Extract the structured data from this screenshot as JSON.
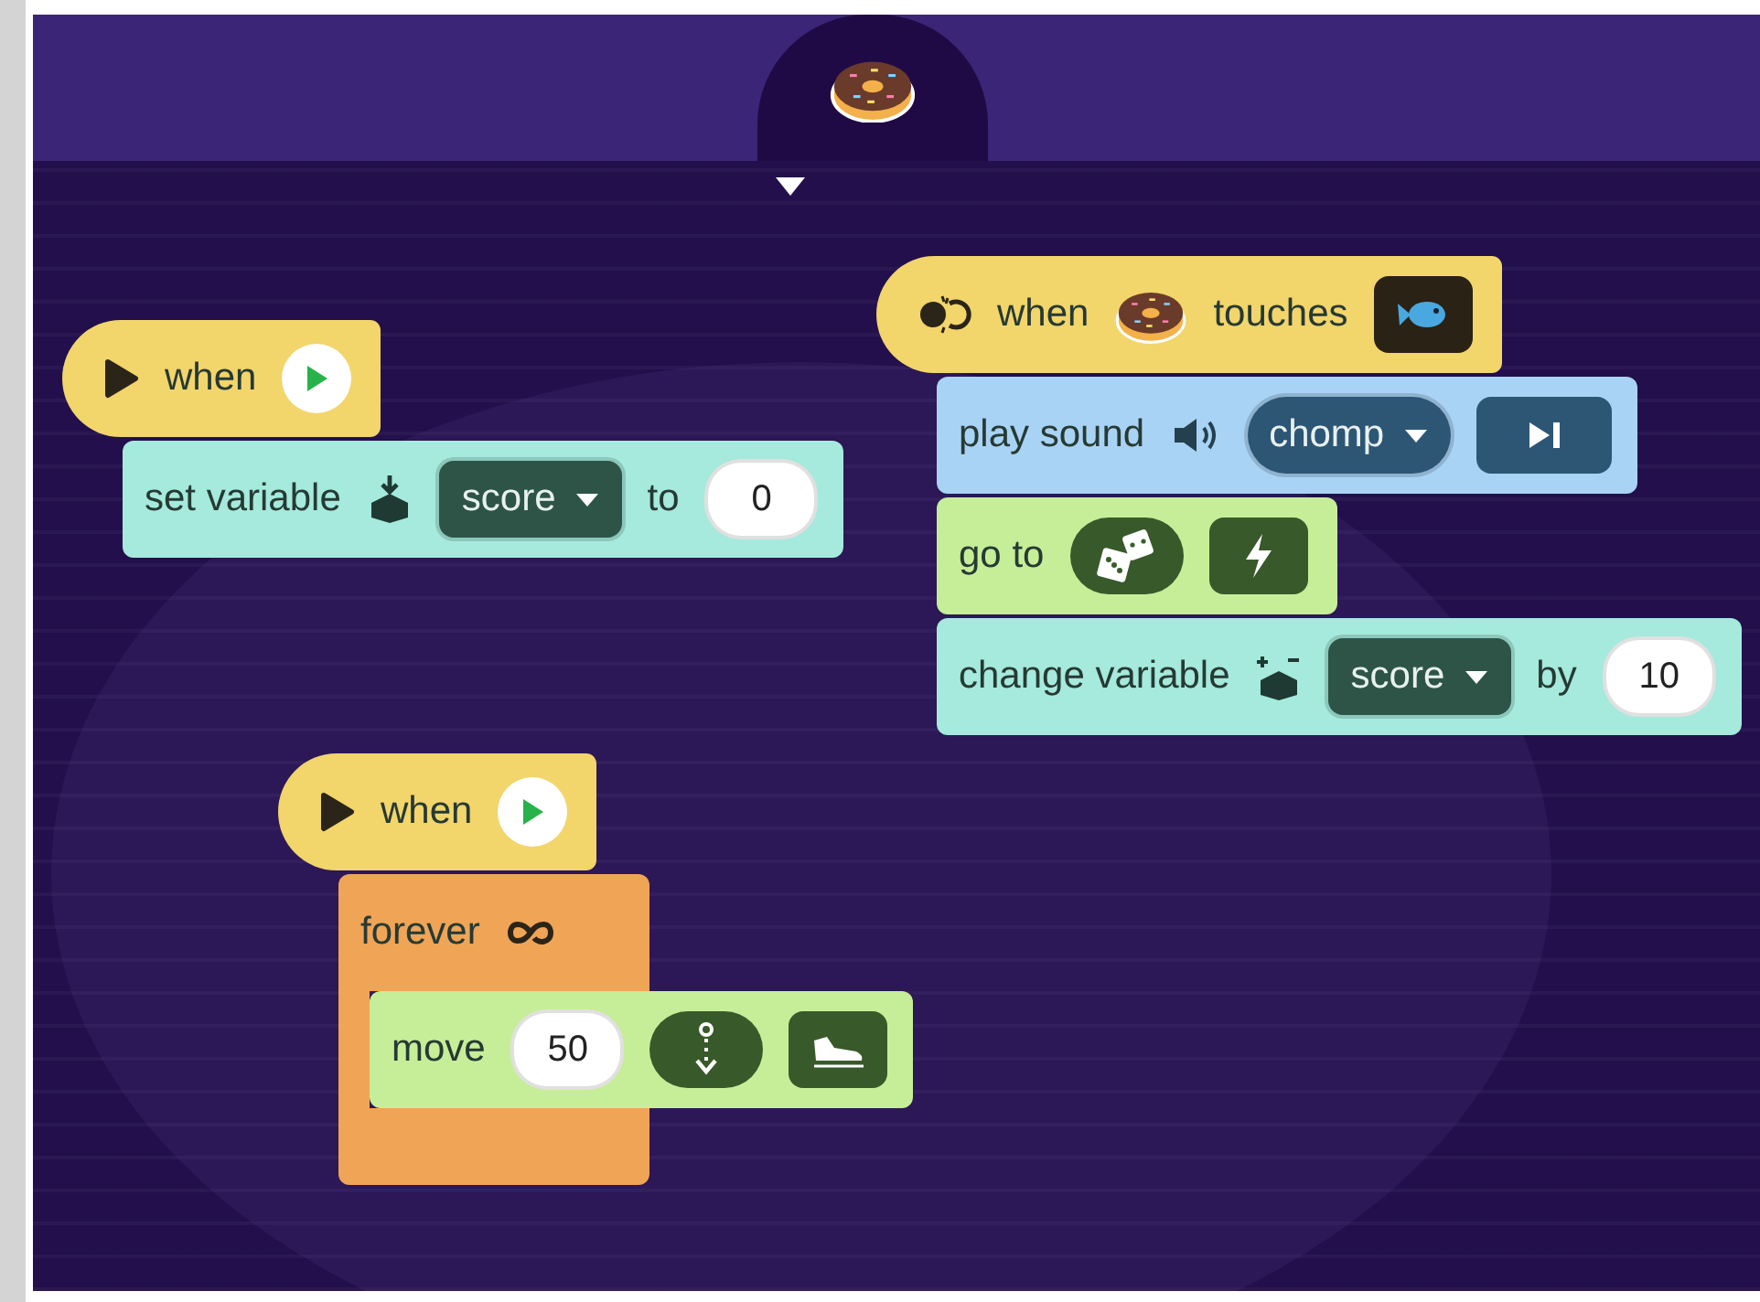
{
  "scripts": [
    {
      "hat": {
        "kind": "flag",
        "label": "when"
      },
      "blocks": [
        {
          "kind": "set_variable",
          "label": "set variable",
          "variable": "score",
          "connector": "to",
          "value": "0"
        }
      ]
    },
    {
      "hat": {
        "kind": "touch",
        "label": "when",
        "label_2": "touches"
      },
      "blocks": [
        {
          "kind": "play_sound",
          "label": "play sound",
          "sound": "chomp"
        },
        {
          "kind": "go_to",
          "label": "go to"
        },
        {
          "kind": "change_variable",
          "label": "change variable",
          "variable": "score",
          "connector": "by",
          "value": "10"
        }
      ]
    },
    {
      "hat": {
        "kind": "flag",
        "label": "when"
      },
      "blocks": [
        {
          "kind": "forever",
          "label": "forever",
          "children": [
            {
              "kind": "move",
              "label": "move",
              "value": "50"
            }
          ]
        }
      ]
    }
  ]
}
